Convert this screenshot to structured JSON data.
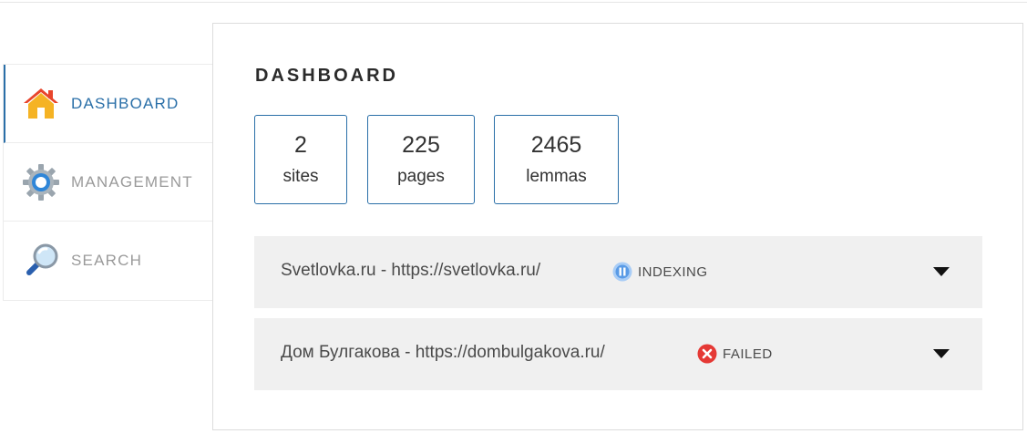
{
  "sidebar": {
    "items": [
      {
        "label": "DASHBOARD",
        "icon": "home-icon",
        "active": true
      },
      {
        "label": "MANAGEMENT",
        "icon": "gear-icon",
        "active": false
      },
      {
        "label": "SEARCH",
        "icon": "magnifier-icon",
        "active": false
      }
    ]
  },
  "main": {
    "title": "DASHBOARD",
    "stats": [
      {
        "value": "2",
        "label": "sites"
      },
      {
        "value": "225",
        "label": "pages"
      },
      {
        "value": "2465",
        "label": "lemmas"
      }
    ],
    "sites": [
      {
        "name": "Svetlovka.ru - https://svetlovka.ru/",
        "status": "INDEXING",
        "status_icon": "pause-icon"
      },
      {
        "name": "Дом Булгакова - https://dombulgakova.ru/",
        "status": "FAILED",
        "status_icon": "error-icon"
      }
    ]
  },
  "colors": {
    "accent": "#2a6fa8",
    "row_bg": "#f0f0f0",
    "failed": "#e53935",
    "indexing": "#5a9be6"
  }
}
